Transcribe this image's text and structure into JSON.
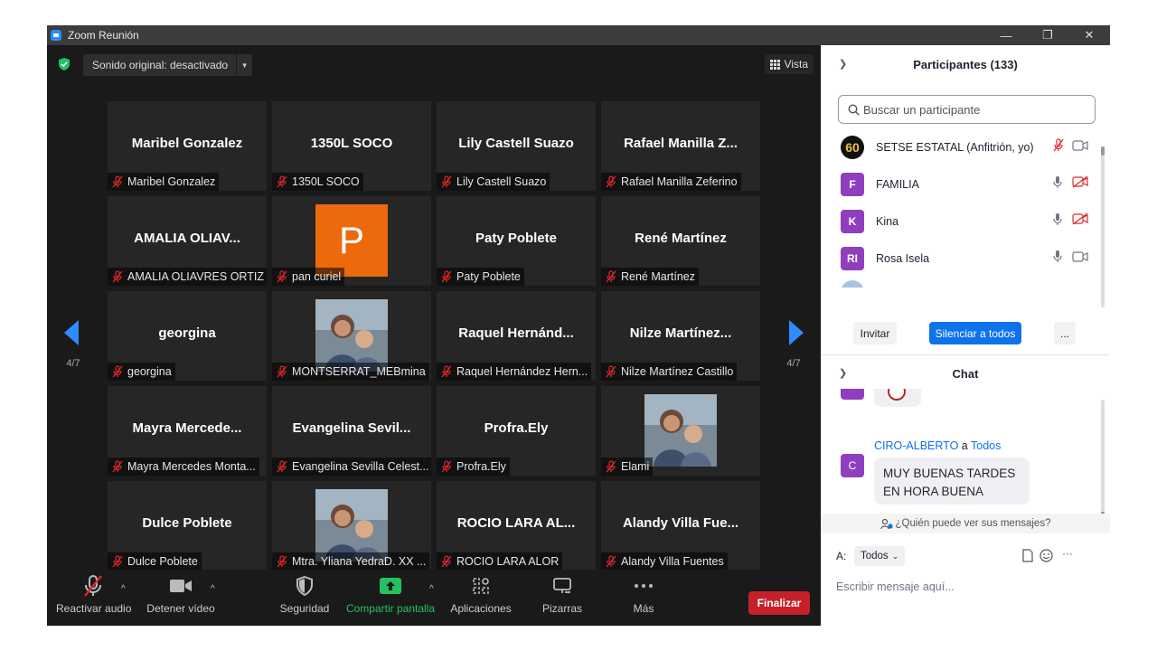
{
  "window": {
    "title": "Zoom Reunión",
    "minimize": "—",
    "restore": "❐",
    "close": "✕"
  },
  "topbar": {
    "sound_label": "Sonido original: desactivado",
    "dropdown": "▼",
    "view_label": "Vista"
  },
  "pagination": {
    "left": "4/7",
    "right": "4/7"
  },
  "tiles": [
    {
      "big": "Maribel Gonzalez",
      "name": "Maribel Gonzalez"
    },
    {
      "big": "1350L SOCO",
      "name": "1350L SOCO"
    },
    {
      "big": "Lily Castell Suazo",
      "name": "Lily Castell Suazo"
    },
    {
      "big": "Rafael  Manilla  Z...",
      "name": "Rafael Manilla Zeferino"
    },
    {
      "big": "AMALIA OLIAV...",
      "name": "AMALIA OLIAVRES ORTIZ"
    },
    {
      "avatar": "P",
      "name": "pan curiel"
    },
    {
      "big": "Paty Poblete",
      "name": "Paty Poblete"
    },
    {
      "big": "René Martínez",
      "name": "René Martínez"
    },
    {
      "big": "georgina",
      "name": "georgina"
    },
    {
      "photo": true,
      "name": "MONTSERRAT_MEBmina"
    },
    {
      "big": "Raquel  Hernánd...",
      "name": "Raquel Hernández Hern..."
    },
    {
      "big": "Nilze  Martínez...",
      "name": "Nilze Martínez Castillo"
    },
    {
      "big": "Mayra  Mercede...",
      "name": "Mayra Mercedes Monta..."
    },
    {
      "big": "Evangelina  Sevil...",
      "name": "Evangelina Sevilla Celest..."
    },
    {
      "big": "Profra.Ely",
      "name": "Profra.Ely"
    },
    {
      "photo": true,
      "name": "Elami"
    },
    {
      "big": "Dulce Poblete",
      "name": "Dulce Poblete"
    },
    {
      "photo": true,
      "name": "Mtra. Yliana YedraD. XX ..."
    },
    {
      "big": "ROCIO LARA AL...",
      "name": "ROCIO LARA ALOR"
    },
    {
      "big": "Alandy  Villa  Fue...",
      "name": "Alandy Villa Fuentes"
    }
  ],
  "toolbar": {
    "audio": "Reactivar audio",
    "video": "Detener vídeo",
    "security": "Seguridad",
    "share": "Compartir pantalla",
    "apps": "Aplicaciones",
    "whiteboards": "Pizarras",
    "more": "Más",
    "end": "Finalizar",
    "caret": "^"
  },
  "participants": {
    "title": "Participantes (133)",
    "search_placeholder": "Buscar un participante",
    "list": [
      {
        "initials": "60",
        "name": "SETSE ESTATAL (Anfitrión, yo)",
        "mic_muted": true,
        "cam_off": false
      },
      {
        "initials": "F",
        "name": "FAMILIA",
        "mic_muted": false,
        "cam_off": true
      },
      {
        "initials": "K",
        "name": "Kina",
        "mic_muted": false,
        "cam_off": true
      },
      {
        "initials": "RI",
        "name": "Rosa Isela",
        "mic_muted": false,
        "cam_off": false
      }
    ],
    "invite": "Invitar",
    "mute_all": "Silenciar a todos",
    "more": "..."
  },
  "chat": {
    "title": "Chat",
    "sender_name": "CIRO-ALBERTO",
    "sender_to": "a",
    "sender_target": "Todos",
    "sender_initial": "C",
    "message": "MUY BUENAS TARDES EN HORA BUENA",
    "who_can_see": "¿Quién puede ver sus mensajes?",
    "to_label": "A:",
    "to_value": "Todos",
    "input_placeholder": "Escribir mensaje aquí...",
    "more": "···"
  },
  "colors": {
    "accent": "#2d8cff",
    "end": "#c6202a",
    "share_green": "#24c160",
    "avatar_purple": "#8f3fbd",
    "avatar_orange": "#ec6a0c"
  }
}
